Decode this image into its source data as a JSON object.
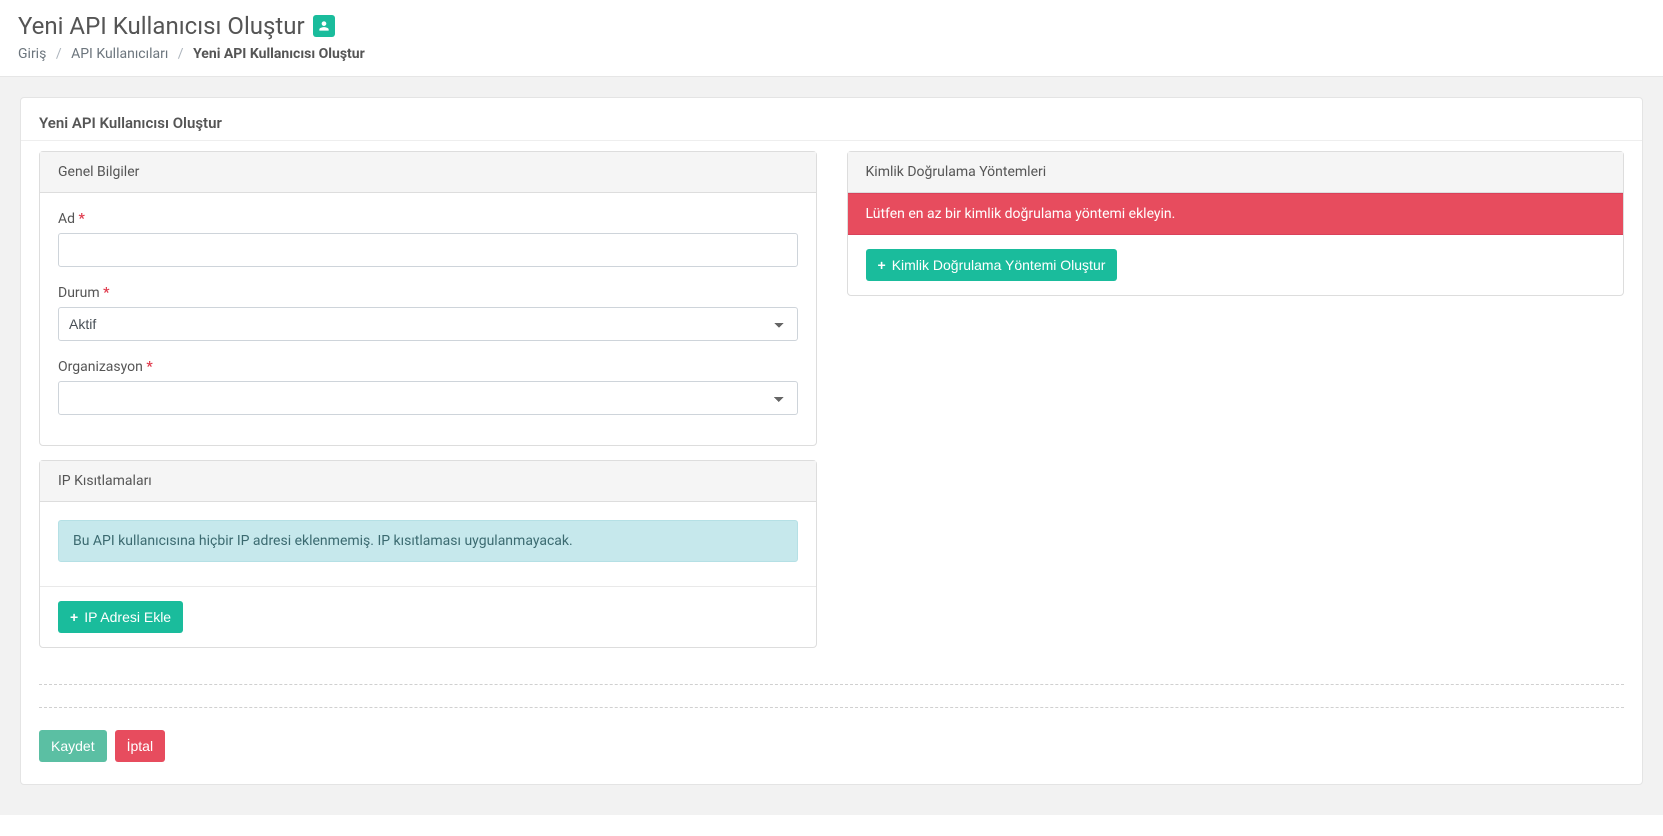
{
  "header": {
    "title": "Yeni API Kullanıcısı Oluştur"
  },
  "breadcrumb": {
    "home": "Giriş",
    "parent": "API Kullanıcıları",
    "current": "Yeni API Kullanıcısı Oluştur"
  },
  "panel": {
    "title": "Yeni API Kullanıcısı Oluştur"
  },
  "general": {
    "header": "Genel Bilgiler",
    "name_label": "Ad",
    "name_value": "",
    "status_label": "Durum",
    "status_selected": "Aktif",
    "org_label": "Organizasyon",
    "org_selected": ""
  },
  "ip": {
    "header": "IP Kısıtlamaları",
    "empty_message": "Bu API kullanıcısına hiçbir IP adresi eklenmemiş. IP kısıtlaması uygulanmayacak.",
    "add_button": "IP Adresi Ekle"
  },
  "auth": {
    "header": "Kimlik Doğrulama Yöntemleri",
    "error_message": "Lütfen en az bir kimlik doğrulama yöntemi ekleyin.",
    "add_button": "Kimlik Doğrulama Yöntemi Oluştur"
  },
  "actions": {
    "save": "Kaydet",
    "cancel": "İptal"
  }
}
